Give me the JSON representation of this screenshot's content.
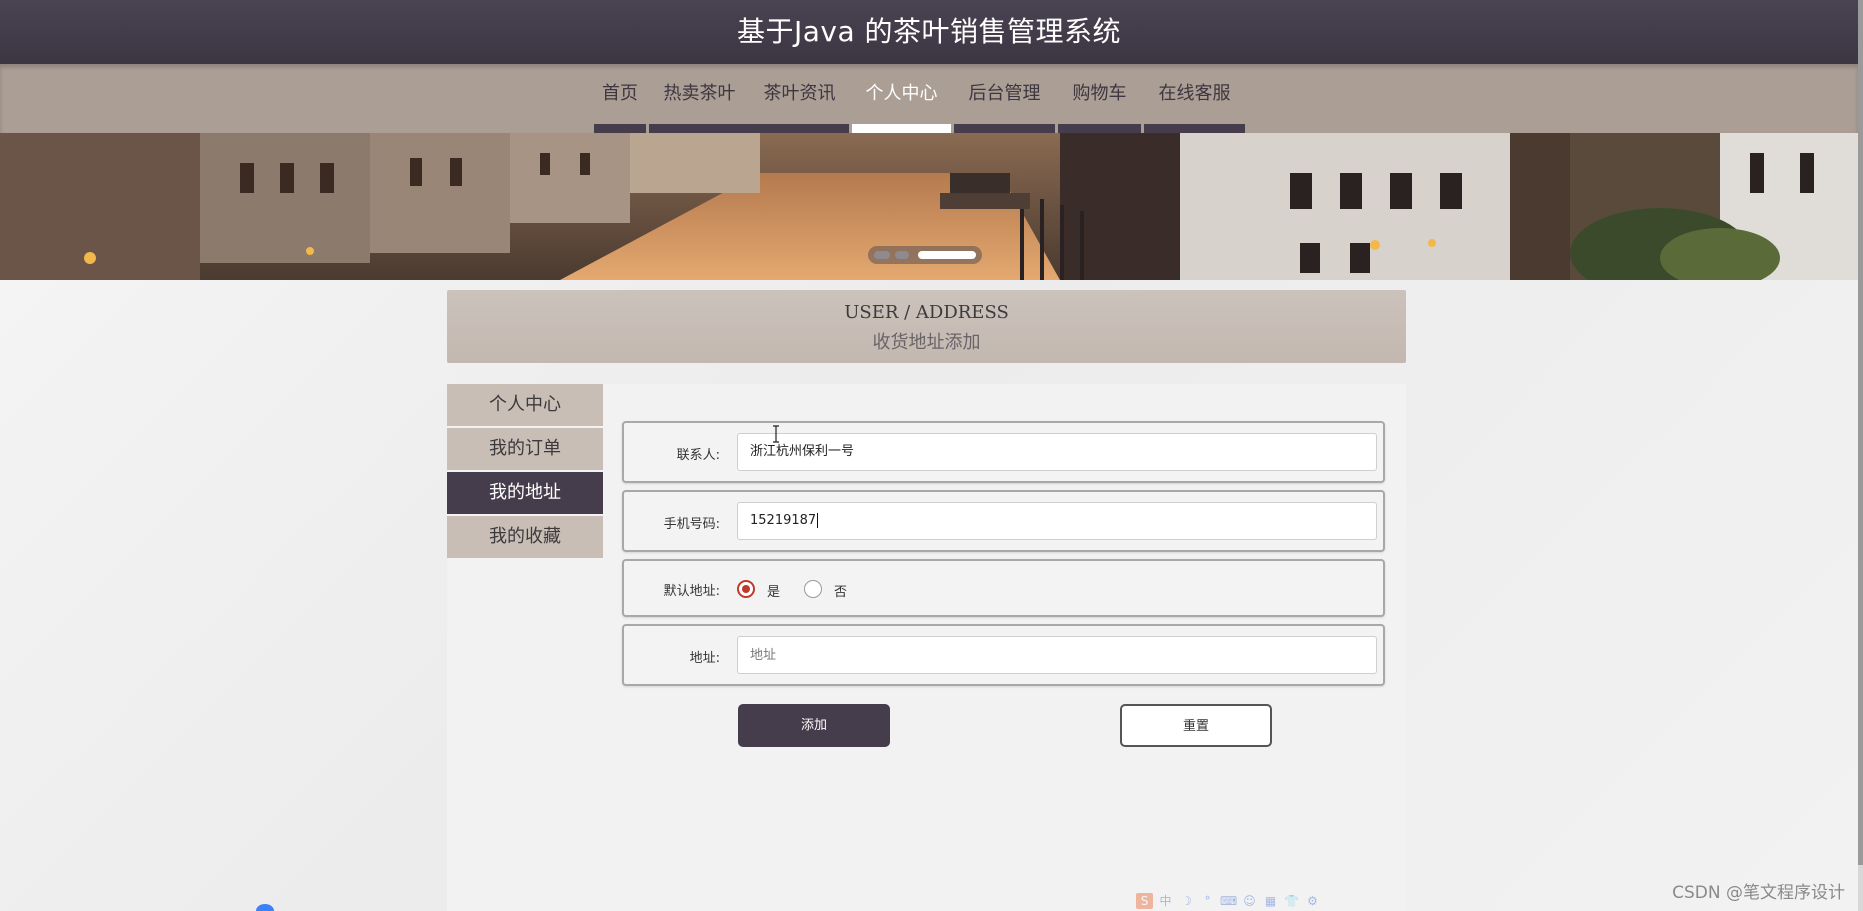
{
  "header": {
    "title": "基于Java 的茶叶销售管理系统"
  },
  "nav": {
    "items": [
      {
        "label": "首页",
        "active": false
      },
      {
        "label": "热卖茶叶",
        "active": false
      },
      {
        "label": "茶叶资讯",
        "active": false
      },
      {
        "label": "个人中心",
        "active": true
      },
      {
        "label": "后台管理",
        "active": false
      },
      {
        "label": "购物车",
        "active": false
      },
      {
        "label": "在线客服",
        "active": false
      }
    ]
  },
  "banner": {
    "active_slide": 3,
    "slide_count": 3
  },
  "title_panel": {
    "en": "USER / ADDRESS",
    "cn": "收货地址添加"
  },
  "side_menu": {
    "items": [
      {
        "label": "个人中心",
        "active": false
      },
      {
        "label": "我的订单",
        "active": false
      },
      {
        "label": "我的地址",
        "active": true
      },
      {
        "label": "我的收藏",
        "active": false
      }
    ]
  },
  "form": {
    "contact": {
      "label": "联系人:",
      "value": "浙江杭州保利一号"
    },
    "phone": {
      "label": "手机号码:",
      "value": "15219187"
    },
    "default_address": {
      "label": "默认地址:",
      "options": [
        {
          "label": "是",
          "checked": true
        },
        {
          "label": "否",
          "checked": false
        }
      ]
    },
    "address": {
      "label": "地址:",
      "placeholder": "地址",
      "value": ""
    },
    "submit_label": "添加",
    "reset_label": "重置"
  },
  "watermark": "CSDN @笔文程序设计",
  "ime_toolbar": [
    "中",
    "☽",
    "°",
    "⌨",
    "☺",
    "▦",
    "👕",
    "⚙"
  ],
  "colors": {
    "header_bg": "#3c3542",
    "nav_bg": "#ab9e95",
    "accent_dark": "#453d4b",
    "panel_bg": "#c8beb6",
    "radio_checked": "#c0392b"
  }
}
